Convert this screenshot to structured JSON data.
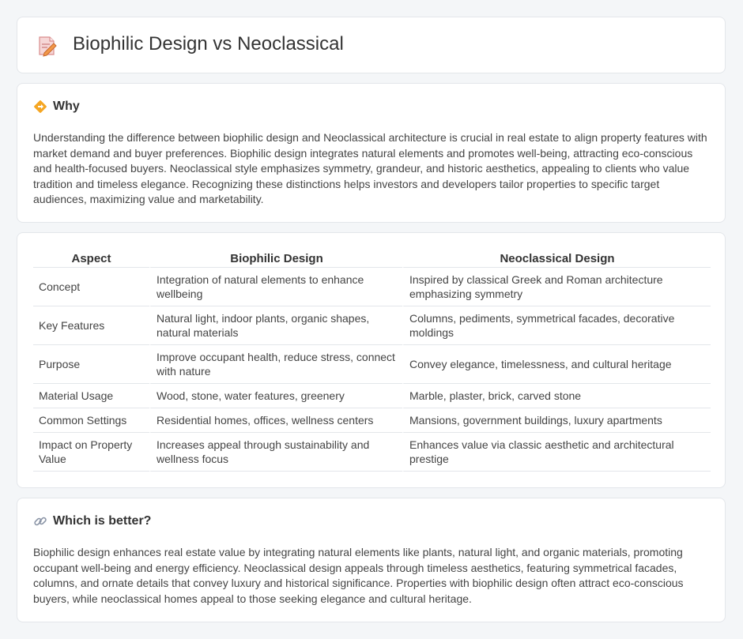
{
  "header": {
    "title": "Biophilic Design vs Neoclassical",
    "icon": "document-pencil-icon"
  },
  "why": {
    "heading": "Why",
    "icon": "diamond-signal-icon",
    "text": "Understanding the difference between biophilic design and Neoclassical architecture is crucial in real estate to align property features with market demand and buyer preferences. Biophilic design integrates natural elements and promotes well-being, attracting eco-conscious and health-focused buyers. Neoclassical style emphasizes symmetry, grandeur, and historic aesthetics, appealing to clients who value tradition and timeless elegance. Recognizing these distinctions helps investors and developers tailor properties to specific target audiences, maximizing value and marketability."
  },
  "comparison": {
    "headers": [
      "Aspect",
      "Biophilic Design",
      "Neoclassical Design"
    ],
    "rows": [
      [
        "Concept",
        "Integration of natural elements to enhance wellbeing",
        "Inspired by classical Greek and Roman architecture emphasizing symmetry"
      ],
      [
        "Key Features",
        "Natural light, indoor plants, organic shapes, natural materials",
        "Columns, pediments, symmetrical facades, decorative moldings"
      ],
      [
        "Purpose",
        "Improve occupant health, reduce stress, connect with nature",
        "Convey elegance, timelessness, and cultural heritage"
      ],
      [
        "Material Usage",
        "Wood, stone, water features, greenery",
        "Marble, plaster, brick, carved stone"
      ],
      [
        "Common Settings",
        "Residential homes, offices, wellness centers",
        "Mansions, government buildings, luxury apartments"
      ],
      [
        "Impact on Property Value",
        "Increases appeal through sustainability and wellness focus",
        "Enhances value via classic aesthetic and architectural prestige"
      ]
    ]
  },
  "better": {
    "heading": "Which is better?",
    "icon": "link-icon",
    "text": "Biophilic design enhances real estate value by integrating natural elements like plants, natural light, and organic materials, promoting occupant well-being and energy efficiency. Neoclassical design appeals through timeless aesthetics, featuring symmetrical facades, columns, and ornate details that convey luxury and historical significance. Properties with biophilic design often attract eco-conscious buyers, while neoclassical homes appeal to those seeking elegance and cultural heritage."
  }
}
